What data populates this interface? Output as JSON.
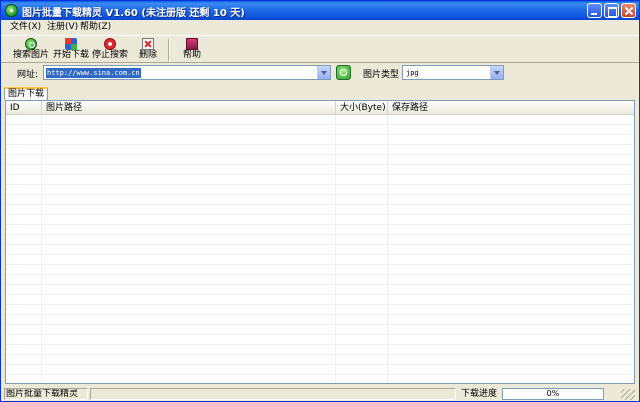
{
  "window": {
    "title": "图片批量下载精灵 V1.60 (未注册版 还剩 10 天)"
  },
  "menu": {
    "items": [
      {
        "label": "文件(X)"
      },
      {
        "label": "注册(V)"
      },
      {
        "label": "帮助(Z)"
      }
    ]
  },
  "toolbar": {
    "search_label": "搜索图片",
    "start_label": "开始下载",
    "stop_label": "停止搜索",
    "delete_label": "删除",
    "help_label": "帮助",
    "icons": [
      "search-icon",
      "start-download-icon",
      "stop-icon",
      "delete-icon",
      "help-icon"
    ]
  },
  "url_row": {
    "label": "网址:",
    "value": "http://www.sina.com.cn",
    "type_label": "图片类型",
    "type_value": "jpg"
  },
  "tabs": [
    {
      "label": "图片下载",
      "active": true
    }
  ],
  "list": {
    "columns": [
      "ID",
      "图片路径",
      "大小(Byte)",
      "保存路径"
    ],
    "rows": []
  },
  "status": {
    "app_name": "图片批量下载精灵",
    "progress_label": "下载进度",
    "progress_text": "0%",
    "progress_value": 0
  },
  "colors": {
    "titlebar": "#0B54DD",
    "window_bg": "#ECE9D8",
    "selection": "#316AC5"
  }
}
